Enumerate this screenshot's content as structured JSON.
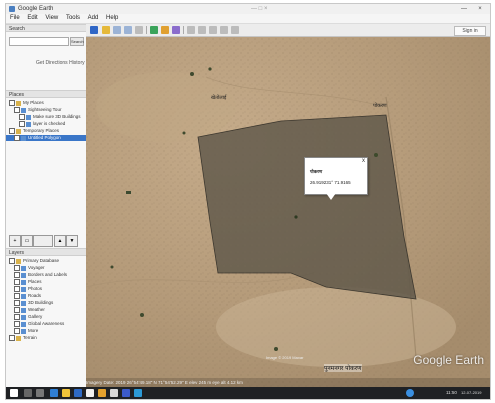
{
  "window": {
    "title": "Google Earth",
    "center_text": "— □ ×",
    "minimize": "—",
    "close": "×"
  },
  "menu": [
    "File",
    "Edit",
    "View",
    "Tools",
    "Add",
    "Help"
  ],
  "toolbar": {
    "sign_in_label": "Sign in"
  },
  "sidebar": {
    "search_header": "Search",
    "search_placeholder": "",
    "search_button": "Search",
    "search_hint": "Get Directions  History",
    "places_header": "Places",
    "places": [
      {
        "label": "My Places",
        "indent": 0
      },
      {
        "label": "Sightseeing Tour",
        "indent": 1
      },
      {
        "label": "Make sure 3D Buildings",
        "indent": 2
      },
      {
        "label": "layer is checked",
        "indent": 2
      },
      {
        "label": "Temporary Places",
        "indent": 0
      },
      {
        "label": "Untitled Polygon",
        "indent": 1,
        "selected": true
      }
    ],
    "layers_header": "Layers",
    "layers": [
      {
        "label": "Primary Database",
        "indent": 0
      },
      {
        "label": "Voyager",
        "indent": 1
      },
      {
        "label": "Borders and Labels",
        "indent": 1
      },
      {
        "label": "Places",
        "indent": 1
      },
      {
        "label": "Photos",
        "indent": 1
      },
      {
        "label": "Roads",
        "indent": 1
      },
      {
        "label": "3D Buildings",
        "indent": 1
      },
      {
        "label": "Weather",
        "indent": 1
      },
      {
        "label": "Gallery",
        "indent": 1
      },
      {
        "label": "Global Awareness",
        "indent": 1
      },
      {
        "label": "More",
        "indent": 1
      },
      {
        "label": "Terrain",
        "indent": 0
      }
    ]
  },
  "map": {
    "labels": [
      {
        "text": "खेतोलाई"
      },
      {
        "text": "पोकरण"
      }
    ],
    "balloon": {
      "title": "पोकरण",
      "coords": "26.919231° 71.9165",
      "close": "x"
    },
    "bottom_label": "पुनमनगर पोकरण",
    "bottom_small": "Image © 2019 Maxar",
    "watermark": "Google Earth",
    "status": "Imagery Date: 2019   26°54'49.18\" N 71°54'52.29\" E  elev 245 m   eye alt 4.12 km"
  },
  "colors": {
    "desert": "#b99f7f",
    "polygon_fill": "#5a5346",
    "selection": "#3a76c8"
  },
  "taskbar": {
    "tray_time": "11:50",
    "tray_date": "12-07-2019"
  }
}
